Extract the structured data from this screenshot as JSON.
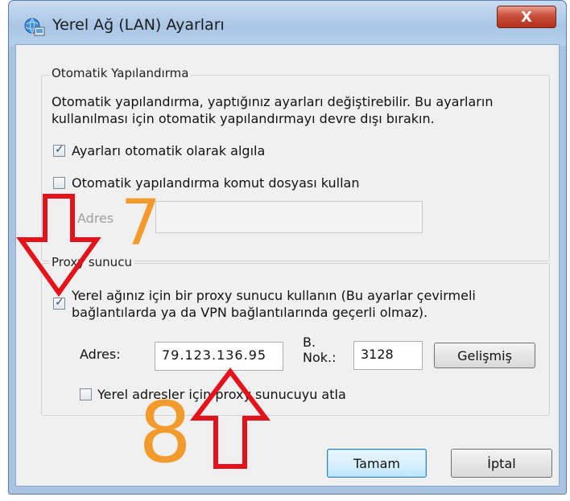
{
  "window": {
    "title": "Yerel Ağ (LAN) Ayarları",
    "close_glyph": "X"
  },
  "auto_config": {
    "legend": "Otomatik Yapılandırma",
    "description": "Otomatik yapılandırma, yaptığınız ayarları değiştirebilir. Bu ayarların kullanılması için otomatik yapılandırmayı devre dışı bırakın.",
    "detect_label": "Ayarları otomatik olarak algıla",
    "detect_checked": true,
    "script_label": "Otomatik yapılandırma komut dosyası kullan",
    "script_checked": false,
    "address_label": "Adres",
    "address_value": ""
  },
  "proxy": {
    "legend": "Proxy sunucu",
    "use_label_line1": "Yerel ağınız için bir proxy sunucu kullanın (Bu ayarlar çevirmeli",
    "use_label_line2": "bağlantılarda ya da VPN bağlantılarında geçerli olmaz).",
    "use_checked": true,
    "address_label": "Adres:",
    "address_value": "79.123.136.95",
    "port_label_line1": "B.",
    "port_label_line2": "Nok.:",
    "port_value": "3128",
    "advanced_label": "Gelişmiş",
    "bypass_label": "Yerel adresler için proxy sunucuyu atla",
    "bypass_checked": false
  },
  "buttons": {
    "ok_label": "Tamam",
    "cancel_label": "İptal"
  },
  "annotations": {
    "step_7": "7",
    "step_8": "8",
    "arrow_color": "#e3121b",
    "number_color": "#f39a2d"
  }
}
